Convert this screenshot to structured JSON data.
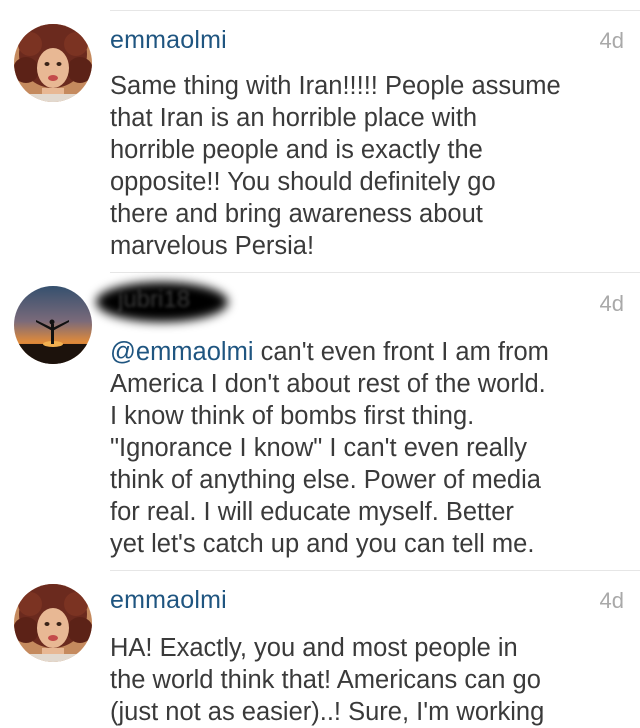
{
  "comments": [
    {
      "username": "emmaolmi",
      "timestamp": "4d",
      "avatar": "user-avatar-photo",
      "lines": [
        "Same thing with Iran!!!!! People assume",
        "that Iran is an horrible place with",
        "horrible people and is exactly the",
        "opposite!! You should definitely go",
        "there and bring awareness about",
        "marvelous Persia!"
      ]
    },
    {
      "username": "jubri18",
      "timestamp": "4d",
      "avatar": "sunset-silhouette-avatar",
      "mention": "@emmaolmi",
      "first_line_rest": " can't even front I am from",
      "lines": [
        "America I don't about rest of the world.",
        "I know think of bombs first thing.",
        "\"Ignorance I know\"  I can't even really",
        "think of anything else.  Power of media",
        "for real.  I will educate myself.  Better",
        "yet let's catch up and you can tell me."
      ]
    },
    {
      "username": "emmaolmi",
      "timestamp": "4d",
      "avatar": "user-avatar-photo",
      "lines": [
        "HA! Exactly, you and most people in",
        "the world think that! Americans can go",
        "(just not as easier)..! Sure, I'm working"
      ]
    }
  ],
  "colors": {
    "username": "#1f5580",
    "timestamp": "#a9a9a9",
    "body_text": "#3a3a3a",
    "divider": "#e6e6e6"
  }
}
